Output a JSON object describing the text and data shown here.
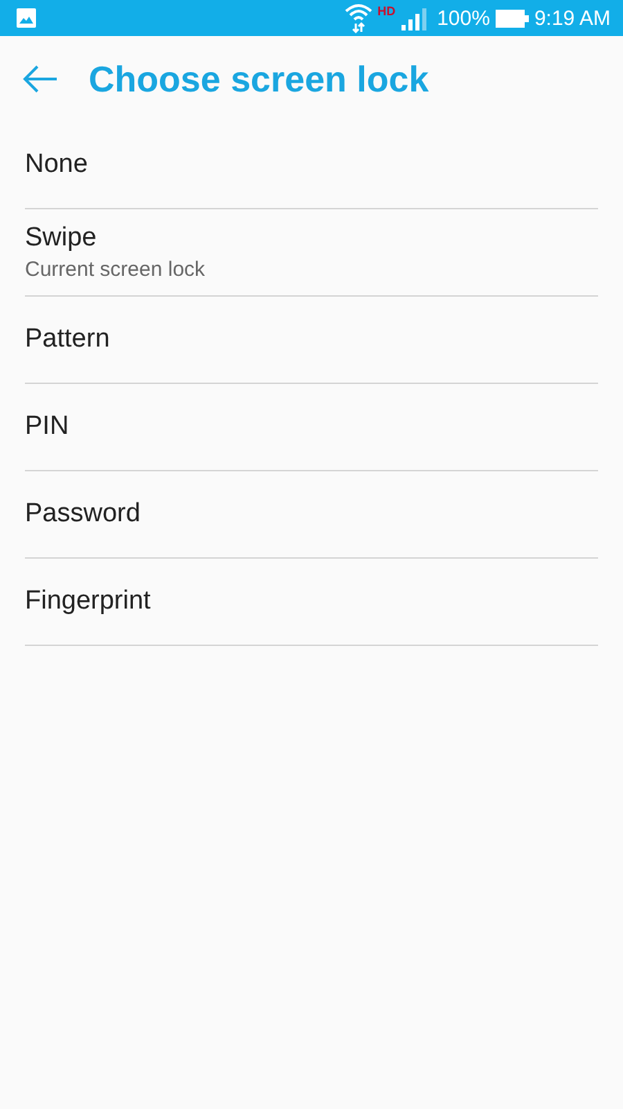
{
  "status_bar": {
    "network_badge": "HD",
    "battery": "100%",
    "time": "9:19 AM"
  },
  "header": {
    "title": "Choose screen lock"
  },
  "options": [
    {
      "label": "None"
    },
    {
      "label": "Swipe",
      "summary": "Current screen lock"
    },
    {
      "label": "Pattern"
    },
    {
      "label": "PIN"
    },
    {
      "label": "Password"
    },
    {
      "label": "Fingerprint"
    }
  ]
}
